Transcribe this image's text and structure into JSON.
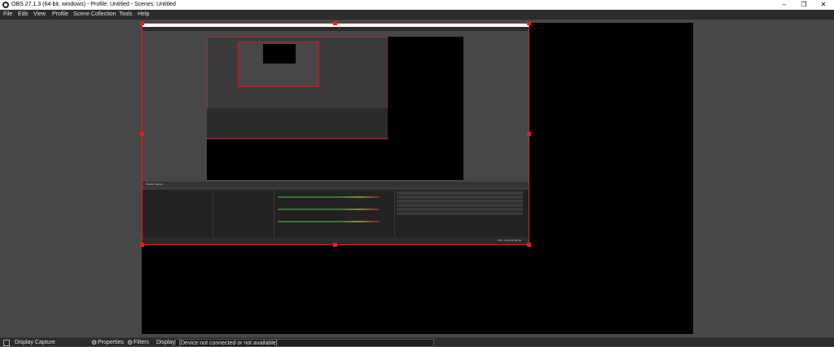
{
  "window": {
    "title": "OBS 27.1.3 (64-bit, windows) - Profile: Untitled - Scenes: Untitled",
    "minimize_glyph": "–",
    "maximize_glyph": "❐",
    "close_glyph": "✕"
  },
  "menu": [
    "File",
    "Edit",
    "View",
    "Profile",
    "Scene Collection",
    "Tools",
    "Help"
  ],
  "nested_capture": {
    "source_bar_text": "Display Capture",
    "status_text": "CPU: 0.6%, 60.00 fps"
  },
  "source_bar": {
    "source_name": "Display Capture",
    "properties_label": "Properties",
    "filters_label": "Filters",
    "display_label": "Display",
    "display_value": "[Device not connected or not available]"
  },
  "colors": {
    "background": "#474747",
    "selection": "#e02020",
    "canvas": "#000000"
  },
  "icons": [
    "obs-logo-icon",
    "gear-icon",
    "filter-icon",
    "checkbox-icon"
  ]
}
